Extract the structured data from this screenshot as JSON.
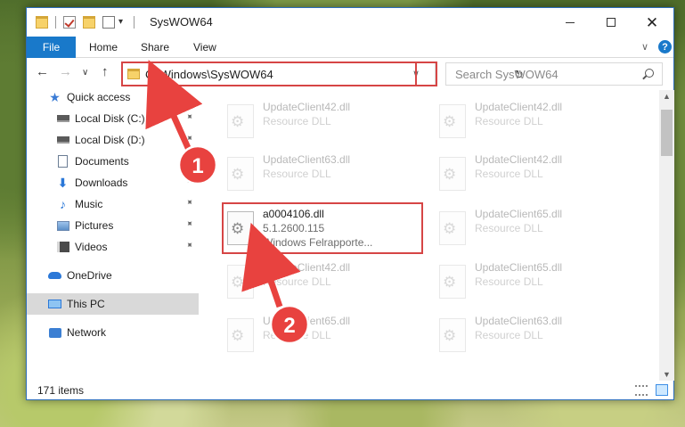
{
  "window": {
    "title": "SysWOW64",
    "minimize_label": "—",
    "close_label": "✕"
  },
  "ribbon": {
    "file": "File",
    "home": "Home",
    "share": "Share",
    "view": "View",
    "chevron": "∨",
    "help": "?"
  },
  "nav": {
    "back": "←",
    "forward": "→",
    "recent": "∨",
    "up": "↑",
    "address": "C:\\Windows\\SysWOW64",
    "address_dropdown": "∨",
    "refresh": "↻",
    "search_placeholder": "Search SysWOW64"
  },
  "sidebar": {
    "items": [
      {
        "label": "Quick access",
        "icon": "star-icon"
      },
      {
        "label": "Local Disk (C:)",
        "icon": "drive-icon",
        "pinned": true
      },
      {
        "label": "Local Disk (D:)",
        "icon": "drive-icon",
        "pinned": true
      },
      {
        "label": "Documents",
        "icon": "documents-icon",
        "pinned": true
      },
      {
        "label": "Downloads",
        "icon": "download-icon",
        "pinned": true
      },
      {
        "label": "Music",
        "icon": "music-icon",
        "pinned": true
      },
      {
        "label": "Pictures",
        "icon": "pictures-icon",
        "pinned": true
      },
      {
        "label": "Videos",
        "icon": "videos-icon",
        "pinned": true
      },
      {
        "label": "OneDrive",
        "icon": "onedrive-icon"
      },
      {
        "label": "This PC",
        "icon": "this-pc-icon",
        "selected": true
      },
      {
        "label": "Network",
        "icon": "network-icon"
      }
    ],
    "pin_glyph": "📌"
  },
  "files": [
    {
      "name": "UpdateClient42.dll",
      "type": "Resource DLL",
      "faded": true
    },
    {
      "name": "UpdateClient42.dll",
      "type": "Resource DLL",
      "faded": true
    },
    {
      "name": "UpdateClient63.dll",
      "type": "Resource DLL",
      "faded": true
    },
    {
      "name": "UpdateClient42.dll",
      "type": "Resource DLL",
      "faded": true
    },
    {
      "name": "a0004106.dll",
      "version": "5.1.2600.115",
      "description": "Windows Felrapporte...",
      "faded": false,
      "highlighted": true
    },
    {
      "name": "UpdateClient65.dll",
      "type": "Resource DLL",
      "faded": true
    },
    {
      "name": "UpdateClient42.dll",
      "type": "Resource DLL",
      "faded": true
    },
    {
      "name": "UpdateClient65.dll",
      "type": "Resource DLL",
      "faded": true
    },
    {
      "name": "UpdateClient65.dll",
      "type": "Resource DLL",
      "faded": true
    },
    {
      "name": "UpdateClient63.dll",
      "type": "Resource DLL",
      "faded": true
    }
  ],
  "status": {
    "item_count": "171 items"
  },
  "annotations": {
    "step1": "1",
    "step2": "2",
    "color": "#e8423f"
  }
}
